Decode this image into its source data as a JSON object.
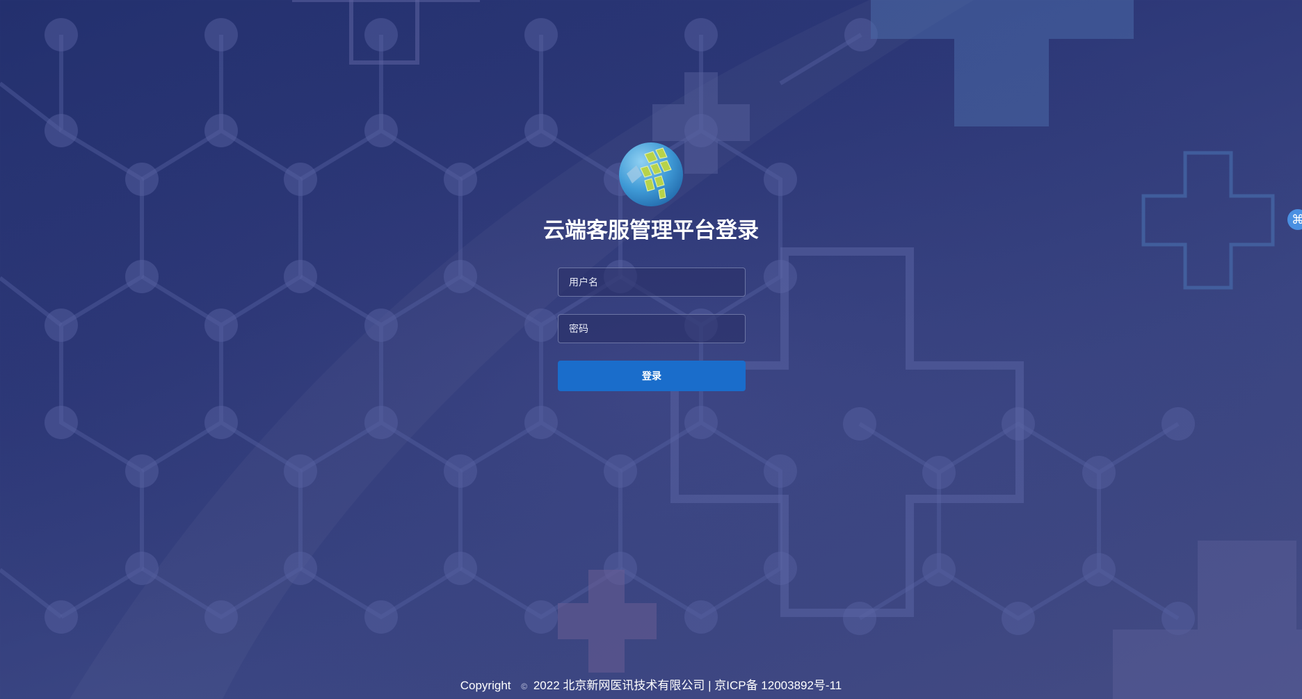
{
  "page": {
    "title": "云端客服管理平台登录"
  },
  "login": {
    "username_placeholder": "用户名",
    "password_placeholder": "密码",
    "submit_label": "登录"
  },
  "footer": {
    "copyright_label": "Copyright",
    "copyright_symbol": "©",
    "copyright_text": "2022 北京新网医讯技术有限公司 | 京ICP备 12003892号-11"
  },
  "side_widget": {
    "icon": "command-icon",
    "glyph": "⌘"
  },
  "colors": {
    "background_top": "#23306e",
    "background_bottom": "#454c84",
    "button": "#1a6dcb",
    "logo_circle": "#4aa3d8",
    "logo_leaf": "#b7d34a"
  }
}
